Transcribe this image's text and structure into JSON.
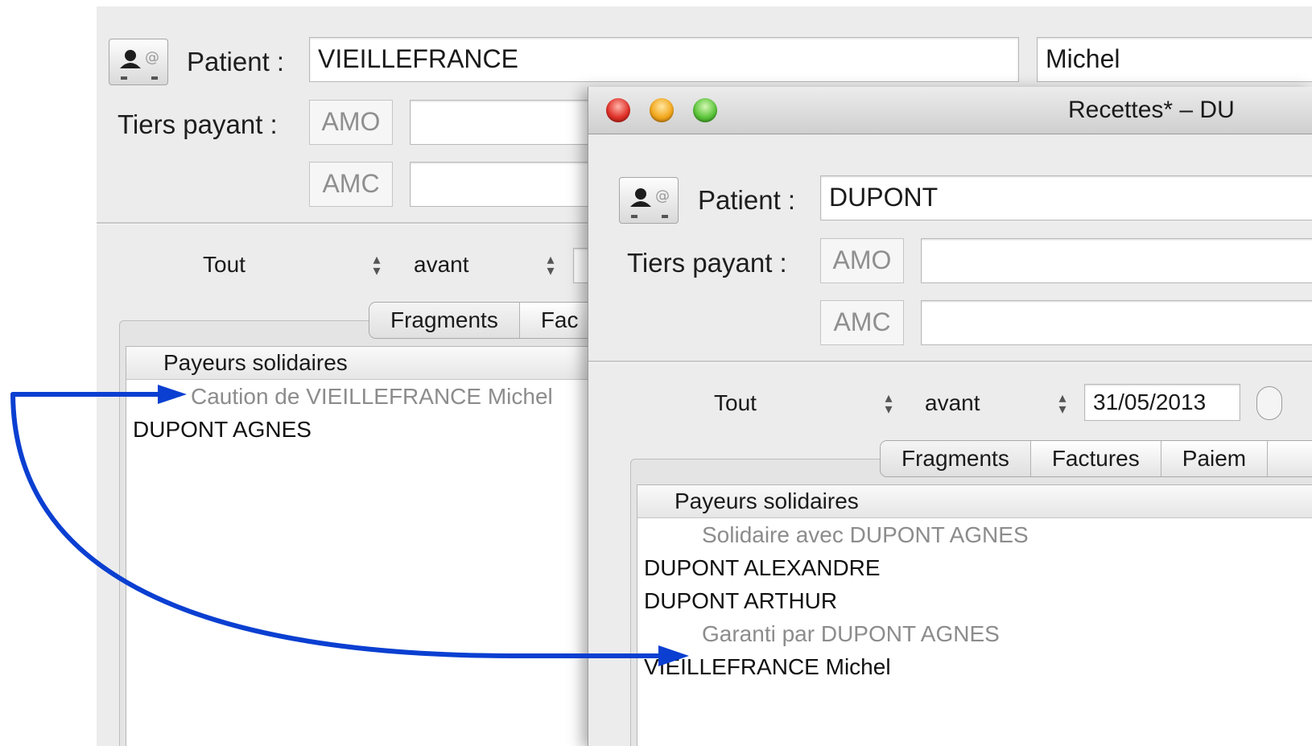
{
  "back_window": {
    "patient_label": "Patient :",
    "patient_lastname": "VIEILLEFRANCE",
    "patient_firstname": "Michel",
    "tiers_payant_label": "Tiers payant :",
    "amo_label": "AMO",
    "amc_label": "AMC",
    "amo_value": "",
    "amc_value": "",
    "filter_scope": "Tout",
    "filter_when": "avant",
    "tabs": [
      "Fragments",
      "Fac"
    ],
    "list_header": "Payeurs solidaires",
    "rows": [
      {
        "text": "Caution de VIEILLEFRANCE Michel",
        "kind": "sub"
      },
      {
        "text": "DUPONT AGNES",
        "kind": "main"
      }
    ]
  },
  "front_window": {
    "title": "Recettes* – DU",
    "patient_label": "Patient :",
    "patient_lastname": "DUPONT",
    "tiers_payant_label": "Tiers payant :",
    "amo_label": "AMO",
    "amc_label": "AMC",
    "amo_value": "",
    "amc_value": "",
    "filter_scope": "Tout",
    "filter_when": "avant",
    "filter_date": "31/05/2013",
    "tabs": [
      "Fragments",
      "Factures",
      "Paiem"
    ],
    "list_header": "Payeurs solidaires",
    "rows": [
      {
        "text": "Solidaire avec DUPONT AGNES",
        "kind": "sub"
      },
      {
        "text": "DUPONT ALEXANDRE",
        "kind": "main"
      },
      {
        "text": "DUPONT ARTHUR",
        "kind": "main"
      },
      {
        "text": "Garanti par DUPONT AGNES",
        "kind": "sub"
      },
      {
        "text": "VIEILLEFRANCE Michel",
        "kind": "main"
      }
    ]
  },
  "annotation": {
    "arrow_color": "#0a3fd1"
  },
  "icons": [
    "contact-card-icon",
    "popup-arrows-icon",
    "close-icon",
    "minimize-icon",
    "zoom-icon"
  ]
}
